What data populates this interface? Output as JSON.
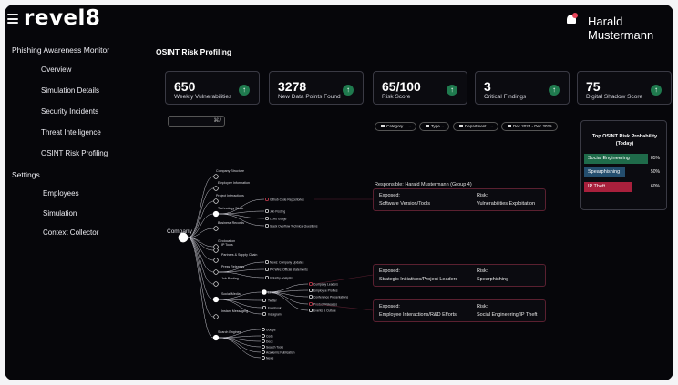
{
  "header": {
    "brand": "revel8",
    "user": "Harald Mustermann"
  },
  "sidebar": {
    "section1": "Phishing Awareness Monitor",
    "items1": [
      "Overview",
      "Simulation Details",
      "Security Incidents",
      "Threat Intelligence",
      "OSINT Risk Profiling"
    ],
    "section2": "Settings",
    "items2": [
      "Employees",
      "Simulation",
      "Context Collector"
    ]
  },
  "main": {
    "title": "OSINT Risk Profiling",
    "stats": [
      {
        "value": "650",
        "label": "Weekly Vulnerabilities"
      },
      {
        "value": "3278",
        "label": "New Data Points Found"
      },
      {
        "value": "65/100",
        "label": "Risk Score"
      },
      {
        "value": "3",
        "label": "Critical Findings"
      },
      {
        "value": "75",
        "label": "Digital Shadow Score"
      }
    ],
    "search_shortcut": "⌘/",
    "filters": [
      "Category",
      "Type",
      "Department",
      "Dec 2024 - Dec 2025"
    ],
    "probability": {
      "title_line1": "Top OSINT Risk Probability",
      "title_line2": "(Today)",
      "items": [
        {
          "label": "Social Engineering",
          "percent": "85%",
          "fraction": 0.85,
          "color": "#1f6b4a"
        },
        {
          "label": "Spearphishing",
          "percent": "50%",
          "fraction": 0.5,
          "color": "#244e6e"
        },
        {
          "label": "IP Theft",
          "percent": "60%",
          "fraction": 0.6,
          "color": "#a8203c"
        }
      ]
    },
    "responsible": "Responsible: Harald Mustermann (Group 4)",
    "findings": [
      {
        "exposed_label": "Exposed:",
        "exposed": "Software Version/Tools",
        "risk_label": "Risk:",
        "risk": "Vulnerabilities Exploitation"
      },
      {
        "exposed_label": "Exposed:",
        "exposed": "Strategic Initiatives/Project Leaders",
        "risk_label": "Risk:",
        "risk": "Spearphishing"
      },
      {
        "exposed_label": "Exposed:",
        "exposed": "Employee Interactions/R&D Efforts",
        "risk_label": "Risk:",
        "risk": "Social Engineering/IP Theft"
      }
    ],
    "tree": {
      "root": "Company",
      "branches": [
        "Company Structure",
        "Employee Information",
        "Project Interactions",
        "Technology Stack",
        "Business Records",
        "Geolocation",
        "IP Tools",
        "Partners & Supply Chain",
        "Press Releases",
        "Job Posting",
        "Social Media",
        "Instant Messaging",
        "Search Engines"
      ],
      "tech_children": [
        "Github Code Repositories",
        "Job Posting",
        "LLMs Usage",
        "Stack Overflow Technical Questions"
      ],
      "press_children": [
        "News: Company Updates",
        "PR Wire: Official Statements",
        "Industry Analysis"
      ],
      "social_children": [
        "LinkedIn",
        "Twitter",
        "Facebook",
        "Instagram"
      ],
      "linkedin_children": [
        "Company Leaders",
        "Employee Profiles",
        "Conference Presentations",
        "Product Releases",
        "Events & Culture"
      ],
      "search_children": [
        "Google",
        "Code",
        "Docs",
        "Search Tools",
        "Academic Publication",
        "News"
      ]
    }
  }
}
